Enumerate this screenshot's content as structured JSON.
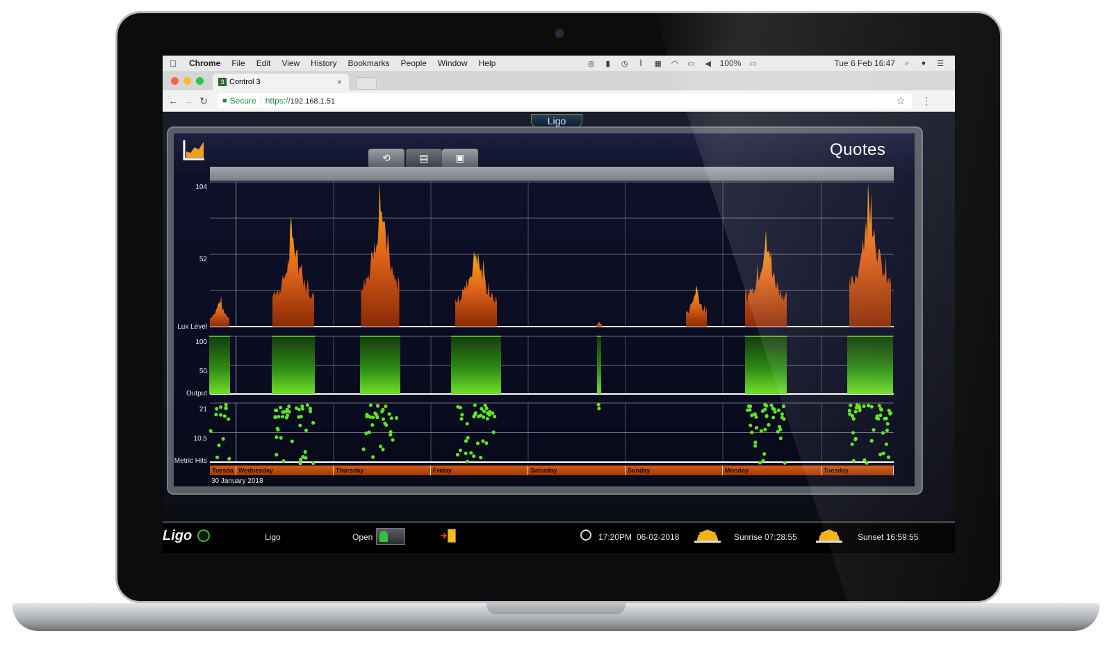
{
  "menubar": {
    "apple_icon": "apple-icon",
    "items": [
      "Chrome",
      "File",
      "Edit",
      "View",
      "History",
      "Bookmarks",
      "People",
      "Window",
      "Help"
    ],
    "battery": "100%",
    "datetime": "Tue 6 Feb  16:47"
  },
  "browser": {
    "tab_title": "Control 3",
    "tab_favicon": "3",
    "secure_label": "Secure",
    "url_scheme": "https://",
    "url_host": "192.168.1.51"
  },
  "app": {
    "brand": "Ligo",
    "page_title": "Quotes",
    "toolbar": [
      "refresh-icon",
      "save-icon",
      "briefcase-icon"
    ]
  },
  "chart_data": [
    {
      "type": "area",
      "ylabel": "Lux Level",
      "y_ticks": [
        "104",
        "52"
      ],
      "ylim": [
        0,
        104
      ],
      "color": "#e0641a",
      "categories": [
        "Tuesday",
        "Wednesday",
        "Thursday",
        "Friday",
        "Saturday",
        "Sunday",
        "Monday",
        "Tuesday"
      ],
      "values": [
        22,
        74,
        100,
        64,
        4,
        34,
        72,
        104
      ]
    },
    {
      "type": "area",
      "ylabel": "Output",
      "y_ticks": [
        "100",
        "50"
      ],
      "ylim": [
        0,
        100
      ],
      "color": "#6fe02a",
      "categories": [
        "Tuesday",
        "Wednesday",
        "Thursday",
        "Friday",
        "Saturday",
        "Sunday",
        "Monday",
        "Tuesday"
      ],
      "values": [
        100,
        100,
        100,
        100,
        100,
        0,
        100,
        100
      ]
    },
    {
      "type": "scatter",
      "ylabel": "Metric Hits",
      "y_ticks": [
        "21",
        "10.5"
      ],
      "ylim": [
        0,
        21
      ],
      "color": "#5ae61e",
      "categories": [
        "Tuesday",
        "Wednesday",
        "Thursday",
        "Friday",
        "Saturday",
        "Sunday",
        "Monday",
        "Tuesday"
      ]
    }
  ],
  "timeline": {
    "days": [
      "Tuesda",
      "Wednesday",
      "Thursday",
      "Friday",
      "Saturday",
      "Sunday",
      "Monday",
      "Tuesday"
    ],
    "start_date": "30 January 2018"
  },
  "statusbar": {
    "logo": "Ligo",
    "name": "Ligo",
    "state": "Open",
    "time": "17:20PM",
    "date": "06-02-2018",
    "sunrise": "Sunrise 07:28:55",
    "sunset": "Sunset 16:59:55"
  }
}
